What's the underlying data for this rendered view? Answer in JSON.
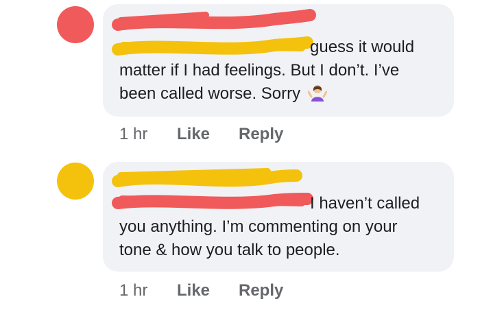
{
  "comments": [
    {
      "text_lines": [
        "guess it would",
        "matter if I had feelings. But I don’t. I’ve",
        "been called worse. Sorry"
      ],
      "emoji": "person-shrugging-emoji",
      "actions": {
        "time": "1 hr",
        "like": "Like",
        "reply": "Reply"
      },
      "redaction_colors": {
        "avatar": "#f05a5a",
        "name": "#f05a5a",
        "tag": "#f4c20d"
      }
    },
    {
      "text_lines": [
        "I haven’t called",
        "you anything. I’m commenting on your",
        "tone & how you talk to people."
      ],
      "actions": {
        "time": "1 hr",
        "like": "Like",
        "reply": "Reply"
      },
      "redaction_colors": {
        "avatar": "#f4c20d",
        "name": "#f4c20d",
        "tag": "#f05a5a"
      }
    }
  ],
  "colors": {
    "bubble_bg": "#f0f2f5",
    "text": "#1c1e21",
    "meta": "#65676b"
  }
}
